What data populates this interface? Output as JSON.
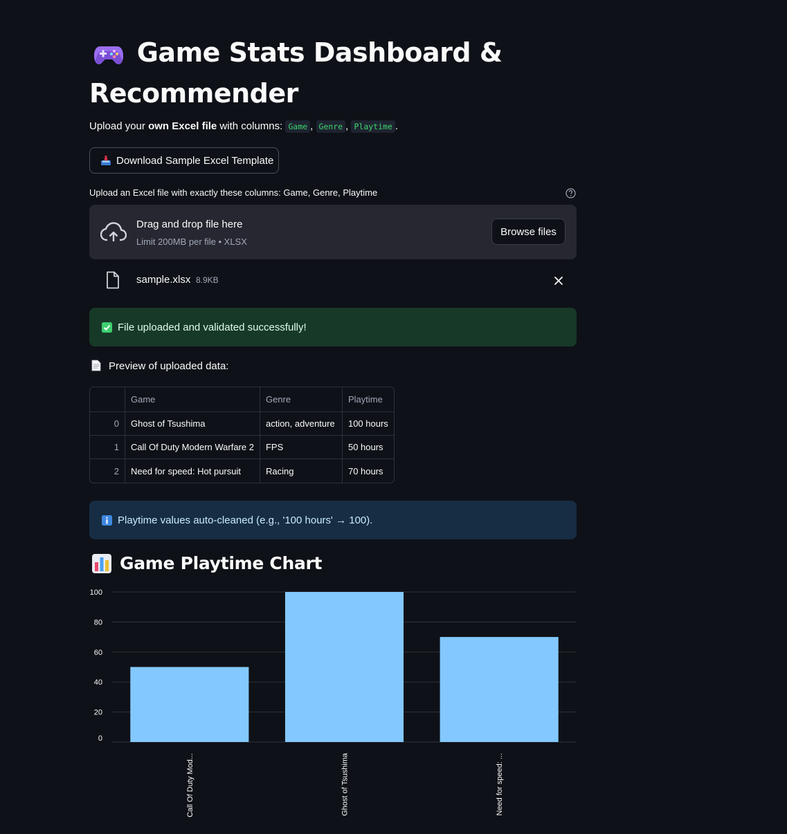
{
  "header": {
    "title": "Game Stats Dashboard & Recommender",
    "title_icon": "video-game-controller-icon"
  },
  "intro": {
    "prefix": "Upload your ",
    "bold": "own Excel file",
    "mid": " with columns: ",
    "columns": [
      "Game",
      "Genre",
      "Playtime"
    ],
    "sep": ", ",
    "suffix": "."
  },
  "download_button": {
    "label": "Download Sample Excel Template",
    "icon": "inbox-tray-icon"
  },
  "uploader": {
    "label": "Upload an Excel file with exactly these columns: Game, Genre, Playtime",
    "drop_title": "Drag and drop file here",
    "drop_subtitle": "Limit 200MB per file • XLSX",
    "browse_label": "Browse files",
    "file_name": "sample.xlsx",
    "file_size": "8.9KB"
  },
  "success_alert": {
    "text": "File uploaded and validated successfully!",
    "icon": "check-mark-icon"
  },
  "preview": {
    "title": "Preview of uploaded data:",
    "columns": [
      "",
      "Game",
      "Genre",
      "Playtime"
    ],
    "rows": [
      [
        "0",
        "Ghost of Tsushima",
        "action, adventure",
        "100 hours"
      ],
      [
        "1",
        "Call Of Duty Modern Warfare 2",
        "FPS",
        "50 hours"
      ],
      [
        "2",
        "Need for speed: Hot pursuit",
        "Racing",
        "70 hours"
      ]
    ]
  },
  "info_alert": {
    "text": "Playtime values auto-cleaned (e.g., '100 hours' → 100).",
    "icon": "information-icon"
  },
  "chart_section": {
    "title": "Game Playtime Chart",
    "icon": "bar-chart-icon"
  },
  "colors": {
    "background": "#0e1117",
    "bar": "#83c9ff",
    "success_bg": "#173928",
    "info_bg": "#172d43",
    "code_text": "#3dd56d"
  },
  "chart_data": {
    "type": "bar",
    "categories": [
      "Call Of Duty Mod...",
      "Ghost of Tsushima",
      "Need for speed: ..."
    ],
    "values": [
      50,
      100,
      70
    ],
    "yticks": [
      0,
      20,
      40,
      60,
      80,
      100
    ],
    "ylim": [
      0,
      100
    ],
    "xlabel": "",
    "ylabel": "",
    "grid": true
  }
}
